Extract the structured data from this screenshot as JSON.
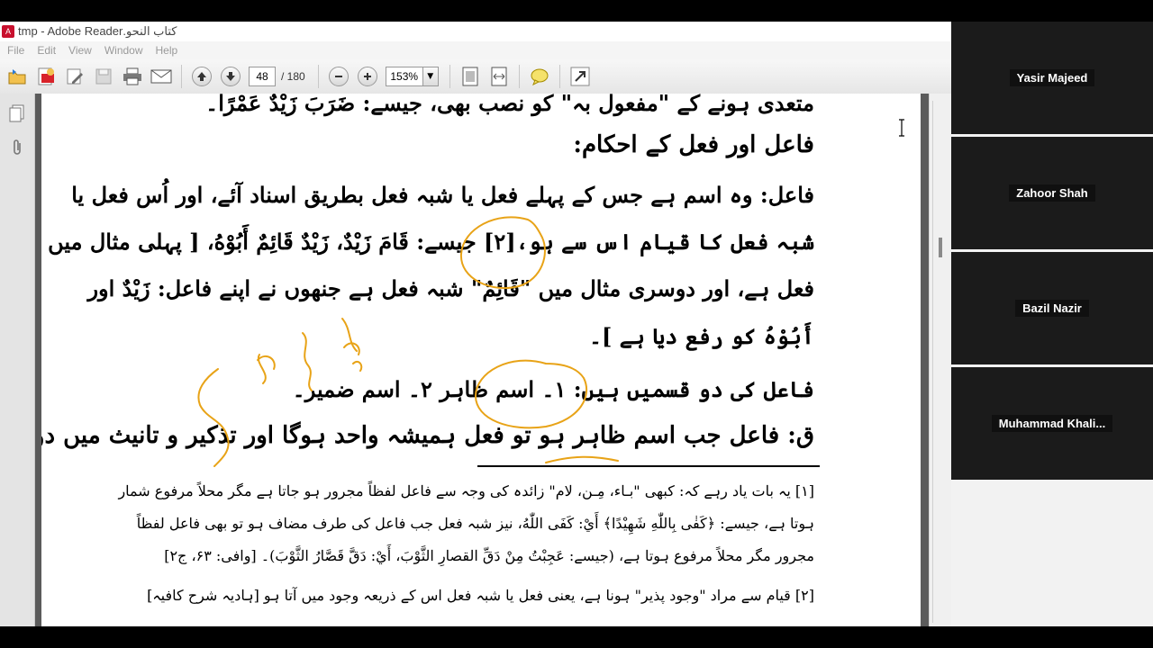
{
  "window": {
    "title": "كتاب النحو.tmp - Adobe Reader"
  },
  "menu": [
    "File",
    "Edit",
    "View",
    "Window",
    "Help"
  ],
  "toolbar": {
    "current_page": "48",
    "total_pages": "/ 180",
    "zoom": "153%"
  },
  "document": {
    "lines": [
      "متعدی ہونے کے \"مفعول بہ\" کو نصب بھی، جیسے: ضَرَبَ زَيْدٌ عَمْرًا۔",
      "فاعل اور فعل کے احکام:",
      "فاعل: وہ اسم ہے جس کے پہلے فعل یا شبہ فعل بطریق اسناد آئے، اور اُس فعل یا",
      "شبہ فعل کا قیام اس سے ہو،[۲] جیسے: قَامَ زَيْدٌ، زَيْدٌ قَائِمٌ أَبُوْهُ، [ پہلی مثال میں \"قَامَ\"",
      "فعل ہے، اور دوسری مثال میں \"قَائِمٌ\" شبہ فعل ہے جنھوں نے اپنے فاعل: زَيْدٌ اور",
      "أَبُوْهُ کو رفع دیا ہے ]۔",
      "فاعل کی دو قسمیں ہیں: ۱۔ اسم ظاہر ۲۔ اسم ضمیر۔",
      "ق: فاعل جب اسم ظاہر ہو تو فعل ہمیشہ واحد ہوگا اور تذکیر و تانیث میں دونوں"
    ],
    "footnotes": [
      "[۱] یہ بات یاد رہے کہ: کبھی \"بـاء، مِـن، لام\" زائدہ کی وجہ سے فاعل لفظاً مجرور ہو جاتا ہے مگر محلاً مرفوع شمار",
      "ہوتا ہے، جیسے: ﴿كَفٰى بِاللّٰهِ شَهِيْدًا﴾ أَيْ: كَفَى اللّٰهُ، نیز شبہ فعل جب فاعل کی طرف مضاف ہو تو بھی فاعل لفظاً",
      "مجرور مگر محلاً مرفوع ہوتا ہے، (جیسے: عَجِبْتُ مِنْ دَقِّ القصارِ الثَّوْبَ، أَيْ: دَقَّ قَصَّارُ الثَّوْبَ)۔ [وافی: ۶۳، ج۲]",
      "[۲] قیام سے مراد \"وجود پذیر\" ہونا ہے، یعنی فعل یا شبہ فعل اس کے ذریعہ وجود میں آتا ہو [ہادیہ شرح کافیہ]"
    ]
  },
  "participants": [
    {
      "name": "Yasir Majeed"
    },
    {
      "name": "Zahoor Shah"
    },
    {
      "name": "Bazil Nazir"
    },
    {
      "name": "Muhammad  Khali..."
    }
  ],
  "colors": {
    "annotation": "#e8a317",
    "tile_bg": "#1b1b1b",
    "page_bg": "#ffffff"
  }
}
